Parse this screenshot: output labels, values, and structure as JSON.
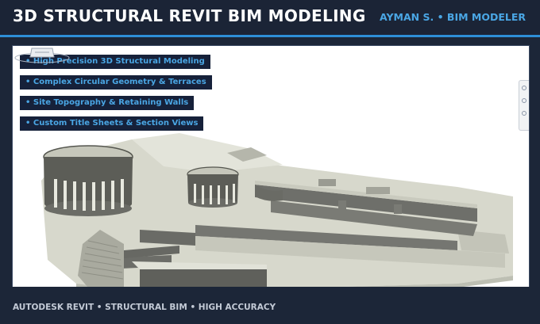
{
  "header": {
    "title": "3D STRUCTURAL REVIT BIM MODELING",
    "author": "AYMAN S. • BIM MODELER"
  },
  "features": [
    "• High Precision 3D Structural Modeling",
    "• Complex Circular Geometry & Terraces",
    "• Site Topography & Retaining Walls",
    "• Custom Title Sheets & Section Views"
  ],
  "viewport": {
    "viewcube_icon": "viewcube-icon",
    "navigation_bar_icon": "navigation-bar-icon"
  },
  "footer": {
    "text": "AUTODESK REVIT • STRUCTURAL BIM • HIGH ACCURACY"
  },
  "colors": {
    "background": "#1c2638",
    "accent": "#2e8fd8",
    "tag_text": "#4aa6e4",
    "model_surface": "#d7d8cc"
  }
}
